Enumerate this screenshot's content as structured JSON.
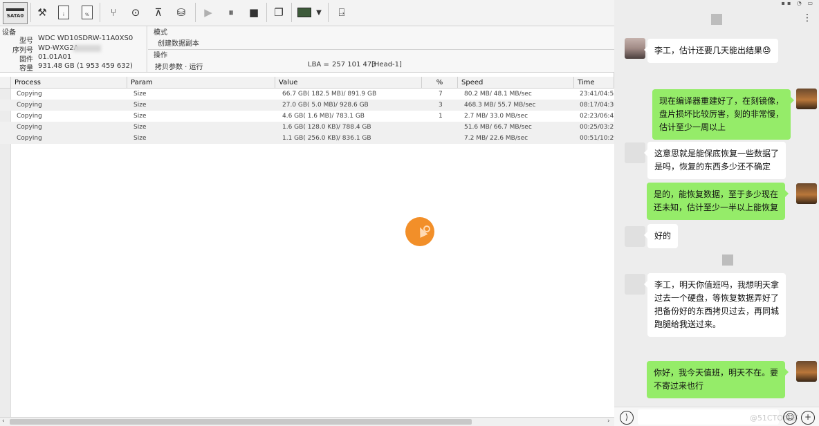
{
  "toolbar": {
    "sata_label": "SATA0",
    "icons": [
      "tools-icon",
      "disk-info-icon",
      "percent-icon",
      "tree-icon",
      "binoculars-icon",
      "sector-icon",
      "copy-disk-icon",
      "play-icon",
      "pause-icon",
      "stop-icon",
      "windows-icon",
      "image-icon",
      "dropdown-icon",
      "exit-icon"
    ]
  },
  "device": {
    "section_label": "设备",
    "model_label": "型号",
    "model_value": "WDC WD10SDRW-11A0XS0",
    "serial_label": "序列号",
    "serial_value": "WD-WXG2A",
    "firmware_label": "固件",
    "firmware_value": "01.01A01",
    "capacity_label": "容量",
    "capacity_value": "931.48 GB (1 953 459 632)"
  },
  "mode": {
    "section_label": "模式",
    "value": "创建数据副本"
  },
  "operation": {
    "section_label": "操作",
    "value": "拷贝参数 · 运行",
    "lba_label": "LBA =",
    "lba_value": "257 101 473",
    "head": "[Head-1]"
  },
  "table": {
    "headers": {
      "process": "Process",
      "param": "Param",
      "value": "Value",
      "percent": "%",
      "speed": "Speed",
      "time": "Time"
    },
    "rows": [
      {
        "process": "Copying",
        "param": "Size",
        "value": "66.7 GB( 182.5 MB)/ 891.9 GB",
        "percent": "7",
        "speed": "80.2 MB/ 48.1 MB/sec",
        "time": "23:41/04:53"
      },
      {
        "process": "Copying",
        "param": "Size",
        "value": "27.0 GB( 5.0 MB)/ 928.6 GB",
        "percent": "3",
        "speed": "468.3 MB/ 55.7 MB/sec",
        "time": "08:17/04:36"
      },
      {
        "process": "Copying",
        "param": "Size",
        "value": "4.6 GB( 1.6 MB)/ 783.1 GB",
        "percent": "1",
        "speed": "2.7 MB/ 33.0 MB/sec",
        "time": "02:23/06:42"
      },
      {
        "process": "Copying",
        "param": "Size",
        "value": "1.6 GB( 128.0 KB)/ 788.4 GB",
        "percent": "",
        "speed": "51.6 MB/ 66.7 MB/sec",
        "time": "00:25/03:21"
      },
      {
        "process": "Copying",
        "param": "Size",
        "value": "1.1 GB( 256.0 KB)/ 836.1 GB",
        "percent": "",
        "speed": "7.2 MB/ 22.6 MB/sec",
        "time": "00:51/10:29"
      }
    ]
  },
  "chat": {
    "more_icon": "⋮",
    "messages": [
      {
        "dir": "in",
        "text": "李工，估计还要几天能出结果😓"
      },
      {
        "dir": "out",
        "text": "现在编译器重建好了，在刻镜像，\n盘片损坏比较厉害，刻的非常慢，\n估计至少一周以上"
      },
      {
        "dir": "in",
        "text": "这意思就是能保底恢复一些数据了\n是吗，恢复的东西多少还不确定"
      },
      {
        "dir": "out",
        "text": "是的，能恢复数据，至于多少现在\n还未知，估计至少一半以上能恢复"
      },
      {
        "dir": "in",
        "text": "好的"
      },
      {
        "dir": "in",
        "text": "李工，明天你值班吗，我想明天拿\n过去一个硬盘，等恢复数据弄好了\n把备份好的东西拷贝过去，再同城\n跑腿给我送过来。"
      },
      {
        "dir": "out",
        "text": "你好，我今天值班，明天不在。要\n不寄过来也行"
      }
    ],
    "watermark": "@51CTO博客",
    "input_icons": [
      "voice-icon",
      "emoji-icon",
      "plus-icon"
    ]
  }
}
